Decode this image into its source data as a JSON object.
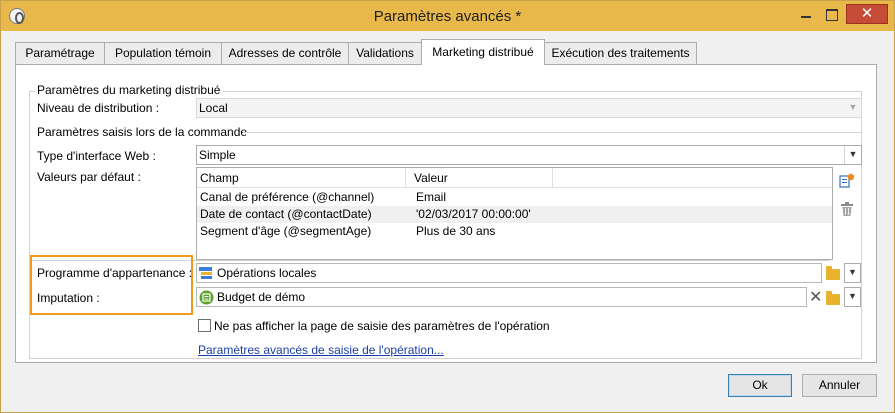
{
  "window": {
    "title": "Paramètres avancés *",
    "close_glyph": "✕"
  },
  "tabs": [
    {
      "label": "Paramétrage"
    },
    {
      "label": "Population témoin"
    },
    {
      "label": "Adresses de contrôle"
    },
    {
      "label": "Validations"
    },
    {
      "label": "Marketing distribué"
    },
    {
      "label": "Exécution des traitements"
    }
  ],
  "active_tab": "Marketing distribué",
  "section_distributed": {
    "title": "Paramètres du marketing distribué",
    "level_label": "Niveau de distribution :",
    "level_value": "Local"
  },
  "section_order": {
    "title": "Paramètres saisis lors de la commande",
    "web_interface_label": "Type d'interface Web :",
    "web_interface_value": "Simple",
    "defaults_label": "Valeurs par défaut :",
    "columns": [
      "Champ",
      "Valeur"
    ],
    "rows": [
      {
        "champ": "Canal de préférence (@channel)",
        "valeur": "Email"
      },
      {
        "champ": "Date de contact (@contactDate)",
        "valeur": "'02/03/2017 00:00:00'"
      },
      {
        "champ": "Segment d'âge (@segmentAge)",
        "valeur": "Plus de 30 ans"
      }
    ]
  },
  "program": {
    "label": "Programme d'appartenance :",
    "value": "Opérations locales",
    "icon": "folder-tree-icon"
  },
  "imputation": {
    "label": "Imputation :",
    "value": "Budget de démo",
    "icon": "budget-icon",
    "clear_glyph": "✕"
  },
  "checkbox": {
    "label": "Ne pas afficher la page de saisie des paramètres de l'opération",
    "checked": false
  },
  "link": {
    "label": "Paramètres avancés de saisie de l'opération..."
  },
  "buttons": {
    "ok": "Ok",
    "cancel": "Annuler"
  },
  "colors": {
    "titlebar": "#e8b84a",
    "highlight": "#f29a1a",
    "link": "#1a3fa8",
    "close_button": "#c74c38"
  }
}
